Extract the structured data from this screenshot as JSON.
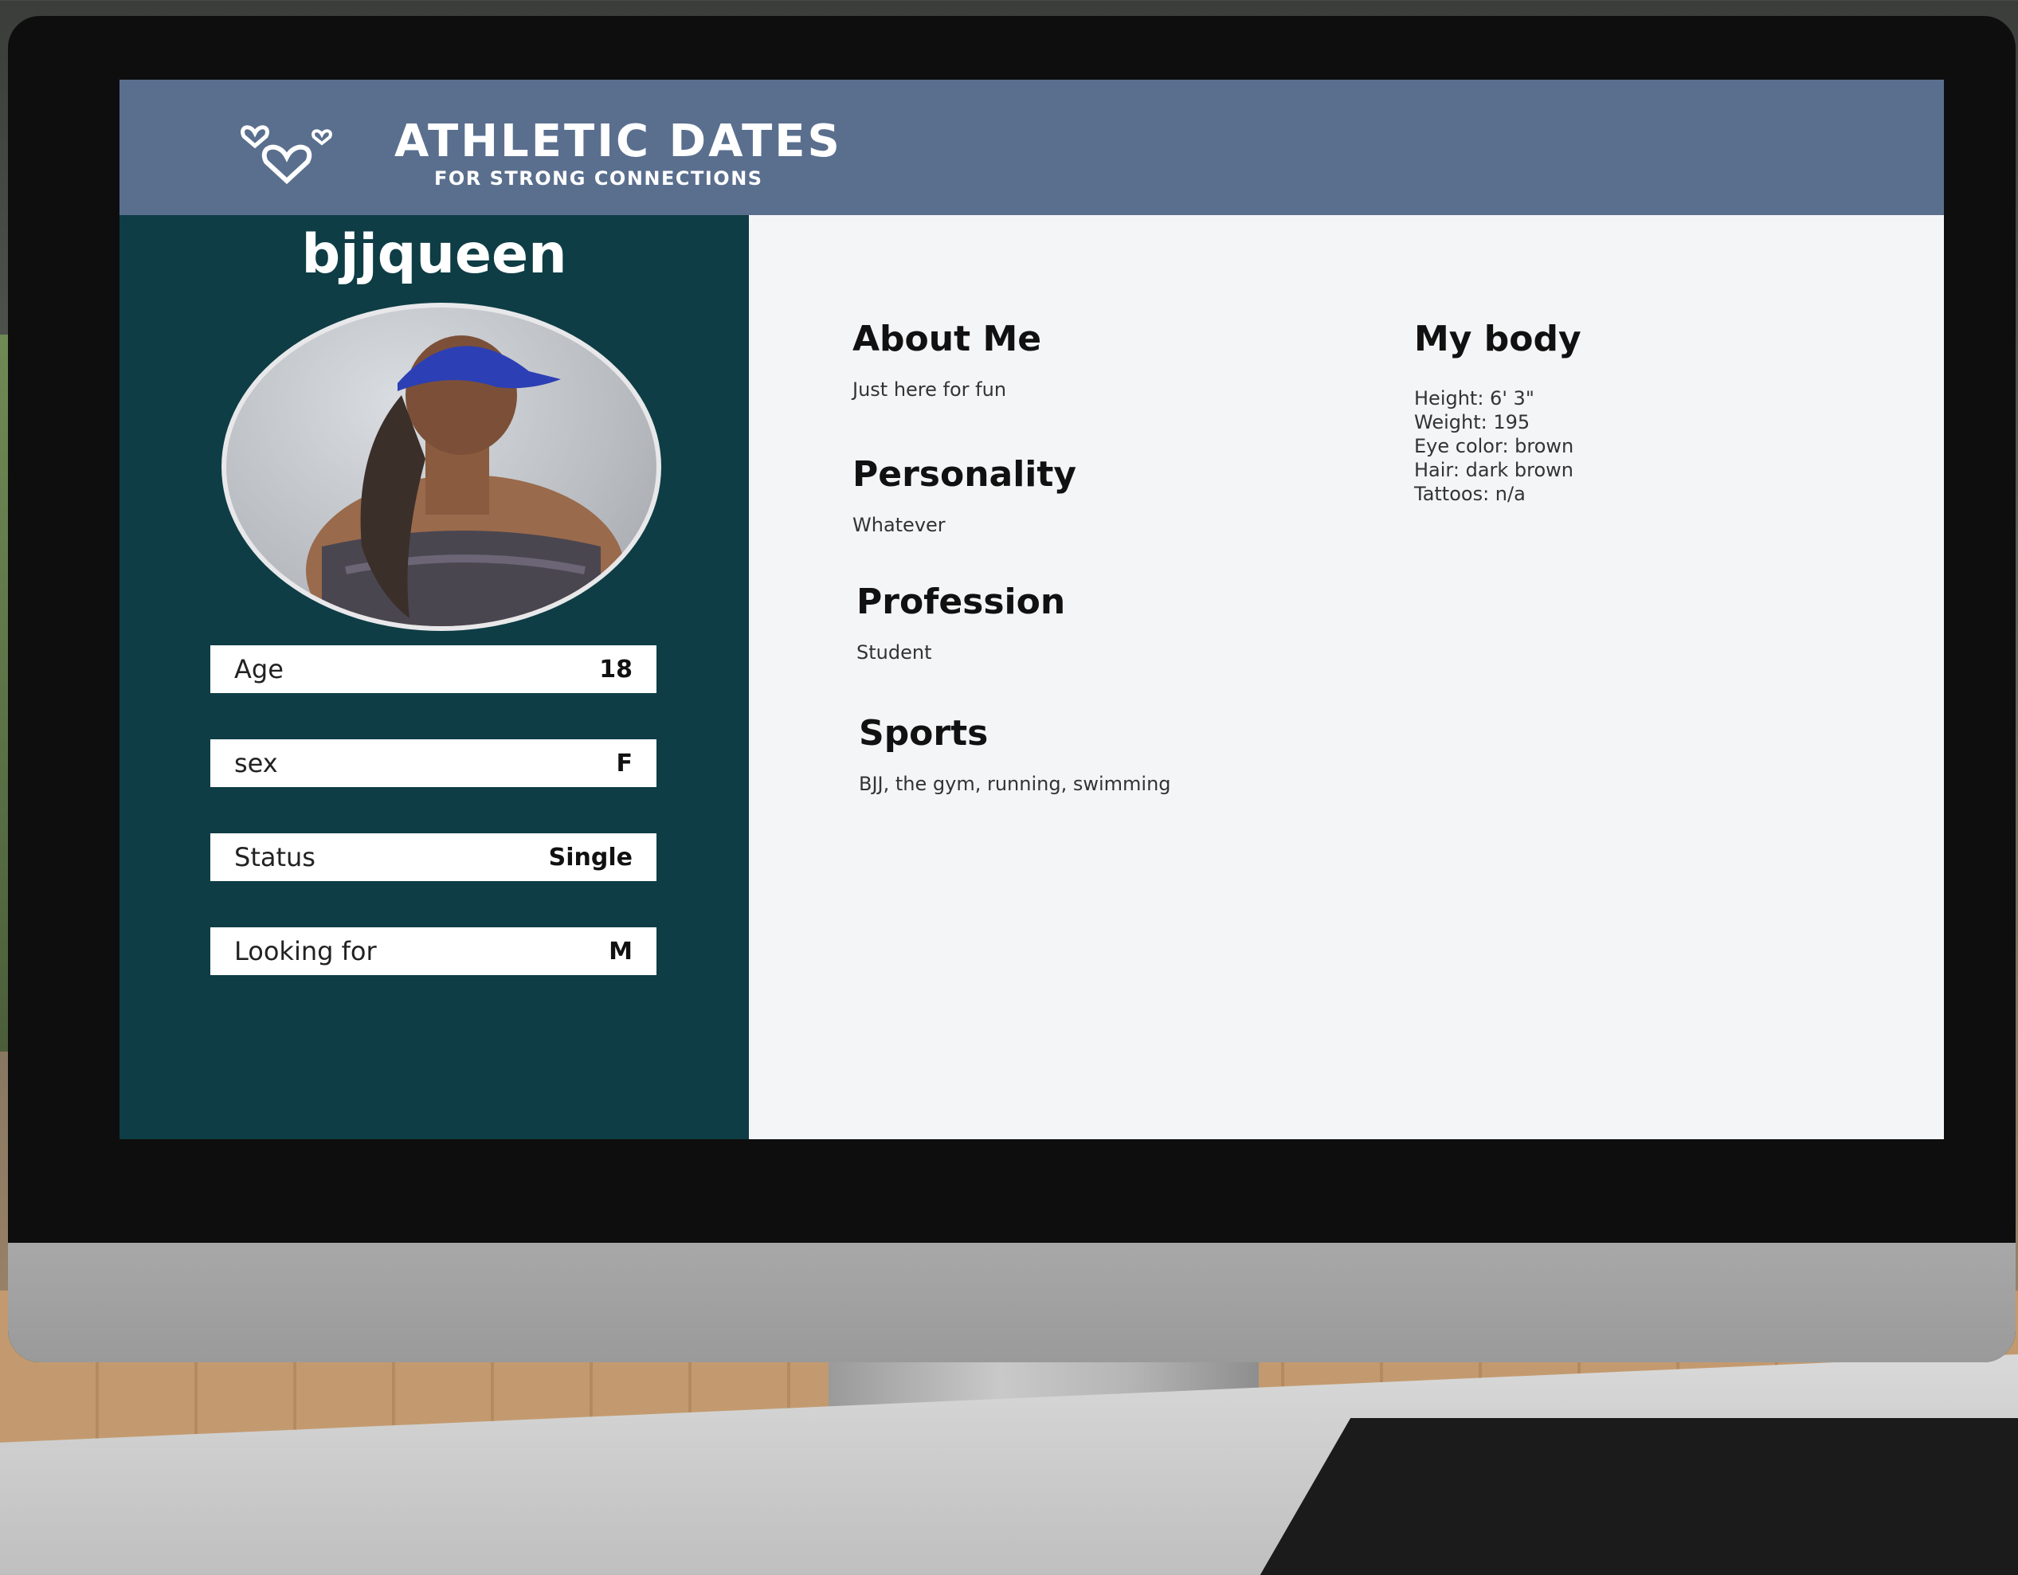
{
  "brand": {
    "title": "ATHLETIC DATES",
    "subtitle": "FOR STRONG CONNECTIONS",
    "logo_icon": "hearts-icon"
  },
  "profile": {
    "username": "bjjqueen",
    "avatar_icon": "profile-photo",
    "info": [
      {
        "label": "Age",
        "value": "18"
      },
      {
        "label": "sex",
        "value": "F"
      },
      {
        "label": "Status",
        "value": "Single"
      },
      {
        "label": "Looking for",
        "value": "M"
      }
    ]
  },
  "sections": {
    "about": {
      "title": "About Me",
      "text": "Just here for fun"
    },
    "personality": {
      "title": "Personality",
      "text": "Whatever"
    },
    "profession": {
      "title": "Profession",
      "text": "Student"
    },
    "sports": {
      "title": "Sports",
      "text": "BJJ, the gym, running, swimming"
    },
    "body": {
      "title": "My body",
      "items": [
        "Height: 6' 3\"",
        "Weight: 195",
        "Eye color: brown",
        "Hair: dark brown",
        "Tattoos: n/a"
      ]
    }
  },
  "colors": {
    "header": "#5a6f8e",
    "sidebar": "#0e3d45",
    "content": "#f4f5f7"
  }
}
